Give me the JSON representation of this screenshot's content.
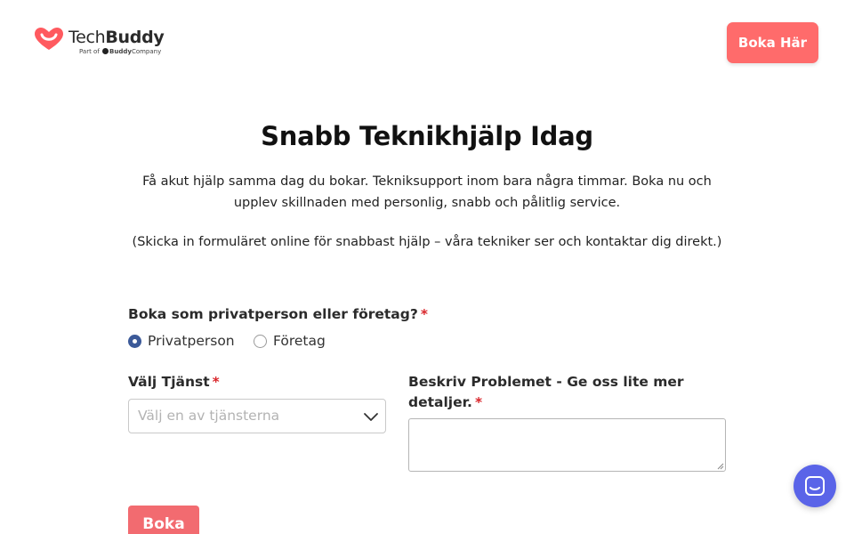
{
  "brand": {
    "name_light": "Tech",
    "name_bold": "Buddy",
    "sub_prefix": "Part of",
    "sub_brand_bold": "Buddy",
    "sub_brand_rest": "Company",
    "color": "#ff5a5f"
  },
  "header": {
    "cta_label": "Boka Här",
    "cta_color": "#ff6b6b"
  },
  "hero": {
    "title": "Snabb Teknikhjälp Idag",
    "text": "Få akut hjälp samma dag du bokar. Tekniksupport inom bara några timmar. Boka nu och upplev skillnaden med personlig, snabb och pålitlig service.",
    "note": "(Skicka in formuläret online för snabbast hjälp – våra tekniker ser och kontaktar dig direkt.)"
  },
  "form": {
    "customer_type": {
      "label": "Boka som privatperson eller företag?",
      "required_mark": "*",
      "options": [
        {
          "label": "Privatperson",
          "selected": true
        },
        {
          "label": "Företag",
          "selected": false
        }
      ]
    },
    "service": {
      "label": "Välj Tjänst",
      "required_mark": "*",
      "placeholder": "Välj en av tjänsterna"
    },
    "problem": {
      "label_line1": "Beskriv Problemet - Ge oss lite mer",
      "label_line2": "detaljer.",
      "required_mark": "*",
      "value": ""
    },
    "submit_label": "Boka",
    "submit_color": "#f26b70",
    "required_color": "#d9262b",
    "radio_checked_color": "#3c5a99"
  },
  "chat": {
    "icon": "chat-icon",
    "color": "#5a64e8"
  }
}
